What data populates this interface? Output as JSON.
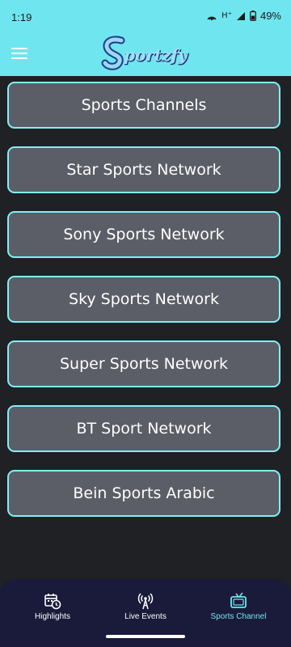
{
  "status_bar": {
    "time": "1:19",
    "battery": "49%"
  },
  "app_bar": {
    "logo_text": "Sportzfy"
  },
  "channels": [
    {
      "label": "Sports Channels"
    },
    {
      "label": "Star Sports Network"
    },
    {
      "label": "Sony Sports Network"
    },
    {
      "label": "Sky Sports Network"
    },
    {
      "label": "Super Sports Network"
    },
    {
      "label": "BT Sport Network"
    },
    {
      "label": "Bein Sports Arabic"
    }
  ],
  "bottom_nav": {
    "items": [
      {
        "label": "Highlights",
        "icon": "calendar-clock-icon"
      },
      {
        "label": "Live Events",
        "icon": "broadcast-tower-icon"
      },
      {
        "label": "Sports Channel",
        "icon": "tv-icon",
        "active": true
      }
    ]
  },
  "colors": {
    "accent": "#6fe6ef",
    "button_bg": "#5b5e66",
    "button_border": "#7ff0f7",
    "page_bg": "#202124",
    "nav_bg": "#1a1b3a"
  }
}
